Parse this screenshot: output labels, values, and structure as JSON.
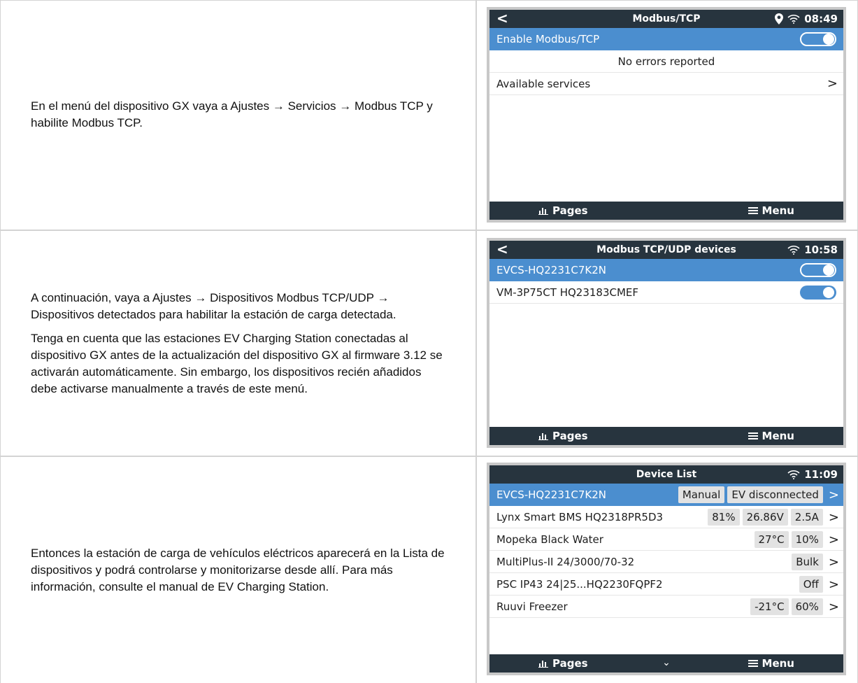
{
  "rows": [
    {
      "text": [
        "En el menú del dispositivo GX vaya a Ajustes → Servicios → Modbus TCP y habilite Modbus TCP."
      ],
      "screen": {
        "title": "Modbus/TCP",
        "time": "08:49",
        "items": [
          {
            "label": "Enable Modbus/TCP"
          },
          {
            "label": "No errors reported"
          },
          {
            "label": "Available services"
          }
        ]
      }
    },
    {
      "text": [
        "A continuación, vaya a Ajustes → Dispositivos Modbus TCP/UDP → Dispositivos detectados para habilitar la estación de carga detectada.",
        "Tenga en cuenta que las estaciones EV Charging Station conectadas al dispositivo GX antes de la actualización del dispositivo GX al firmware 3.12 se activarán automáticamente. Sin embargo, los dispositivos recién añadidos debe activarse manualmente a través de este menú."
      ],
      "screen": {
        "title": "Modbus TCP/UDP devices",
        "time": "10:58",
        "items": [
          {
            "label": "EVCS-HQ2231C7K2N"
          },
          {
            "label": "VM-3P75CT HQ23183CMEF"
          }
        ]
      }
    },
    {
      "text": [
        "Entonces la estación de carga de vehículos eléctricos aparecerá en la Lista de dispositivos y podrá controlarse y monitorizarse desde allí. Para más información, consulte el manual de EV Charging Station."
      ],
      "screen": {
        "title": "Device List",
        "time": "11:09",
        "items": [
          {
            "label": "EVCS-HQ2231C7K2N",
            "values": [
              "Manual",
              "EV disconnected"
            ]
          },
          {
            "label": "Lynx Smart BMS HQ2318PR5D3",
            "values": [
              "81%",
              "26.86V",
              "2.5A"
            ]
          },
          {
            "label": "Mopeka Black Water",
            "values": [
              "27°C",
              "10%"
            ]
          },
          {
            "label": "MultiPlus-II 24/3000/70-32",
            "values": [
              "Bulk"
            ]
          },
          {
            "label": "PSC IP43 24|25...HQ2230FQPF2",
            "values": [
              "Off"
            ]
          },
          {
            "label": "Ruuvi Freezer",
            "values": [
              "-21°C",
              "60%"
            ]
          }
        ]
      }
    }
  ],
  "ui": {
    "pages_label": "Pages",
    "menu_label": "Menu",
    "back_glyph": "<",
    "chevron_glyph": ">",
    "down_glyph": "⌄"
  },
  "colors": {
    "selected": "#4b8ecf",
    "bar": "#27343e"
  }
}
